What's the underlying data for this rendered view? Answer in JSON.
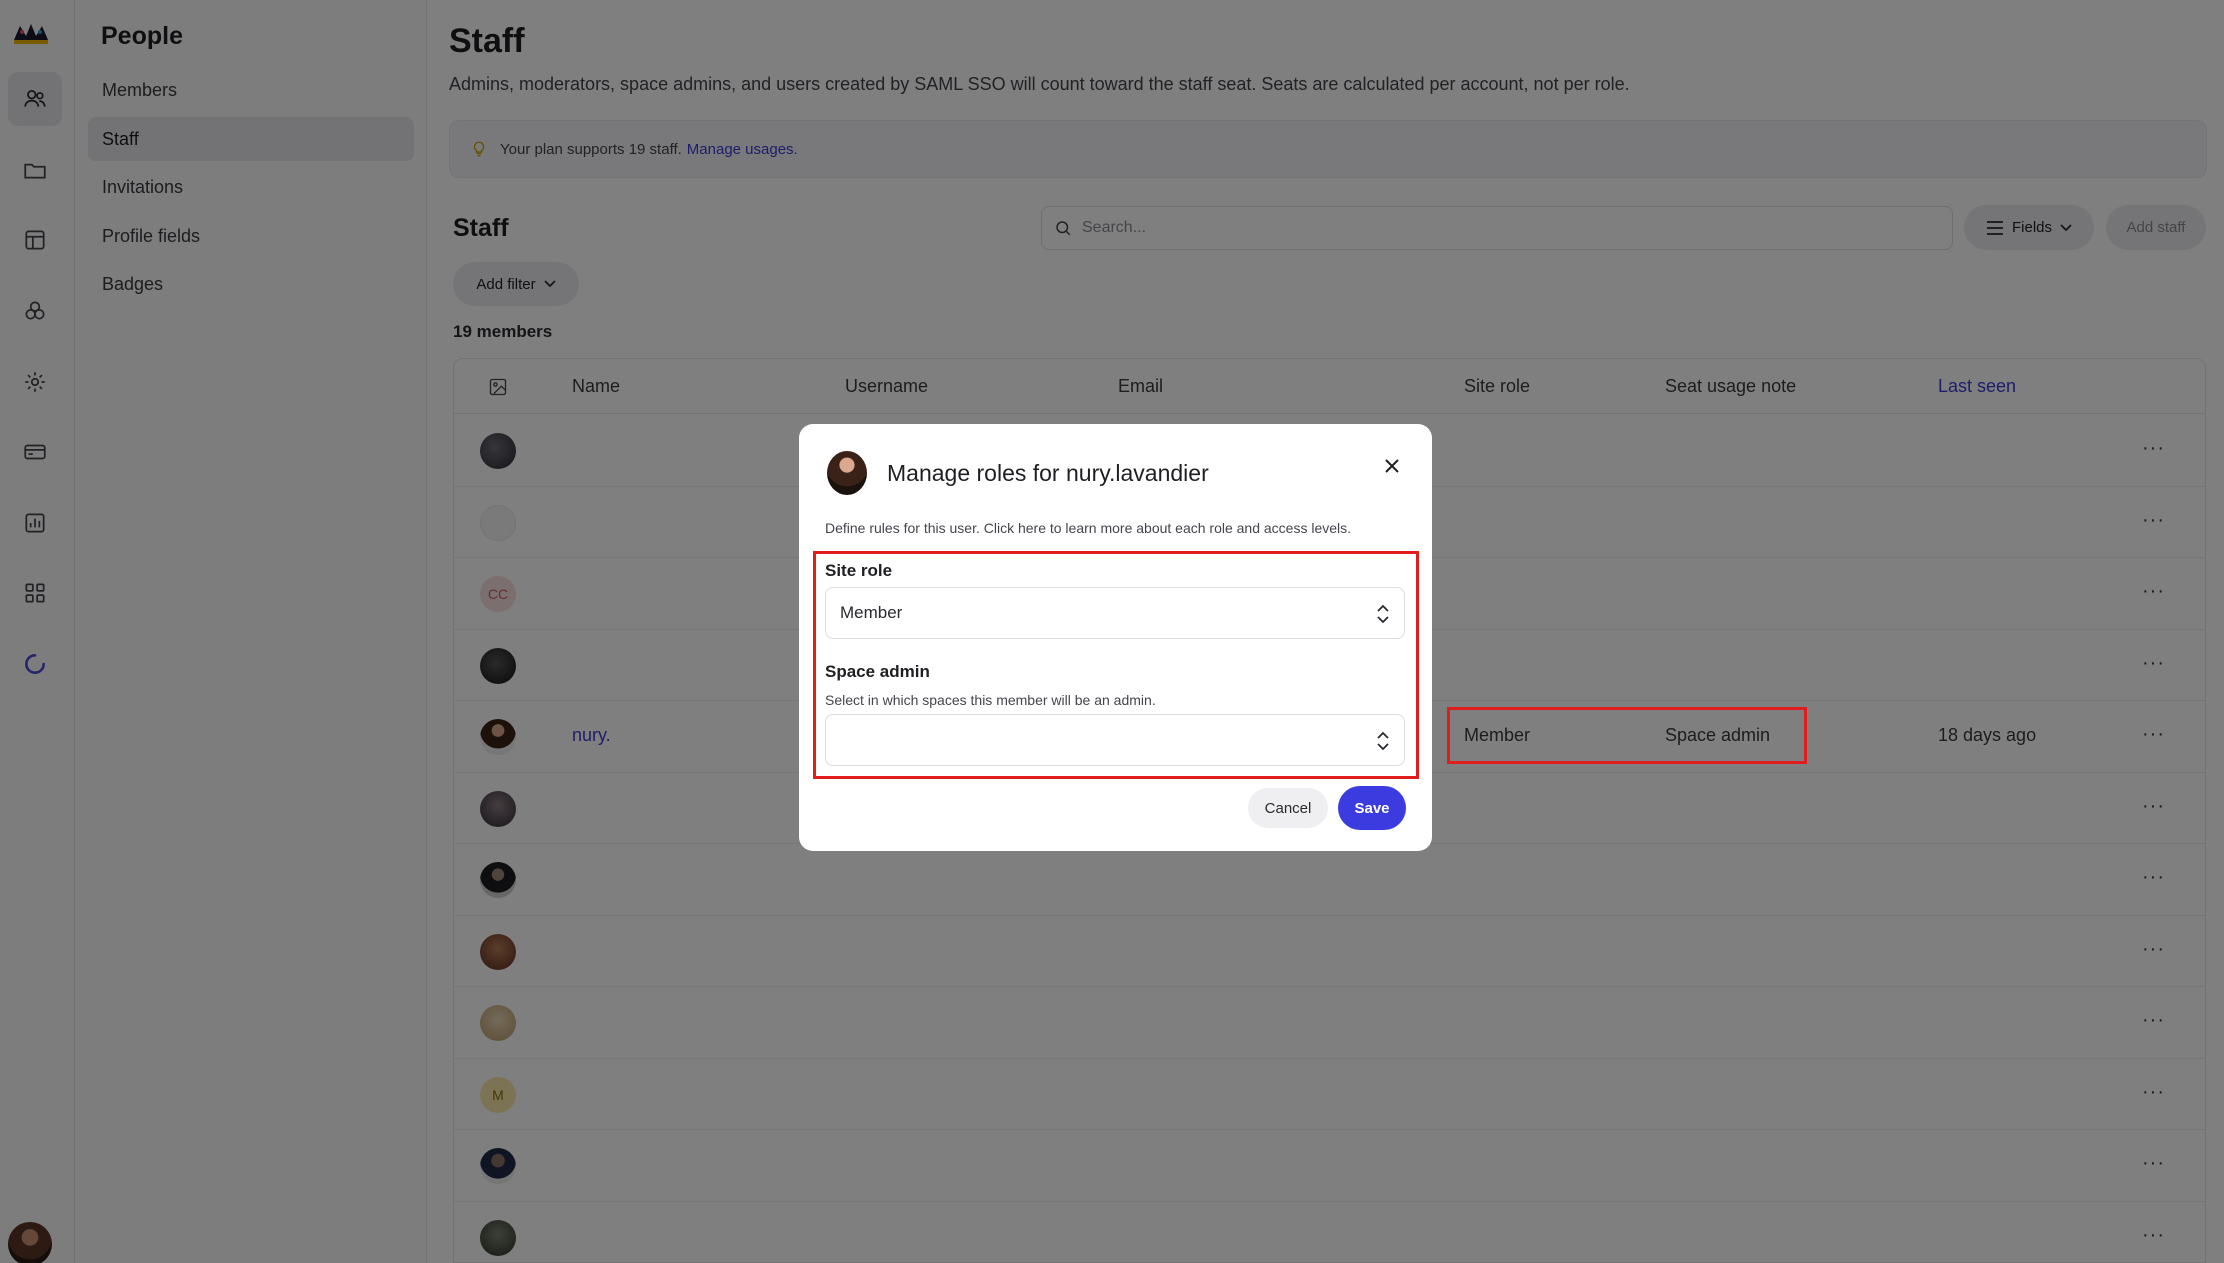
{
  "sidebar": {
    "title": "People",
    "items": [
      {
        "label": "Members",
        "active": false
      },
      {
        "label": "Staff",
        "active": true
      },
      {
        "label": "Invitations",
        "active": false
      },
      {
        "label": "Profile fields",
        "active": false
      },
      {
        "label": "Badges",
        "active": false
      }
    ]
  },
  "rail": {
    "icons": [
      "members-icon",
      "folder-icon",
      "layout-icon",
      "groups-icon",
      "gear-icon",
      "card-icon",
      "chart-icon",
      "apps-icon",
      "loading-icon"
    ]
  },
  "page": {
    "title": "Staff",
    "description": "Admins, moderators, space admins, and users created by SAML SSO will count toward the staff seat. Seats are calculated per account, not per role.",
    "plan_text": "Your plan supports 19 staff.",
    "plan_link": "Manage usages."
  },
  "list": {
    "title": "Staff",
    "search_placeholder": "Search...",
    "fields_label": "Fields",
    "add_staff_label": "Add staff",
    "add_filter_label": "Add filter",
    "count_label": "19 members",
    "columns": [
      "Name",
      "Username",
      "Email",
      "Site role",
      "Seat usage note",
      "Last seen"
    ],
    "rows": [
      {
        "avatar": "photo",
        "name": "",
        "site_role": "",
        "seat_note": "",
        "last_seen": ""
      },
      {
        "avatar": "photo",
        "name": "",
        "site_role": "",
        "seat_note": "",
        "last_seen": ""
      },
      {
        "avatar": "initials",
        "initials": "CC",
        "name": "",
        "site_role": "",
        "seat_note": "",
        "last_seen": ""
      },
      {
        "avatar": "photo",
        "name": "",
        "site_role": "",
        "seat_note": "",
        "last_seen": ""
      },
      {
        "avatar": "photo",
        "name": "nury.",
        "site_role": "Member",
        "seat_note": "Space admin",
        "last_seen": "18 days ago"
      },
      {
        "avatar": "photo",
        "name": "",
        "site_role": "",
        "seat_note": "",
        "last_seen": ""
      },
      {
        "avatar": "photo",
        "name": "",
        "site_role": "",
        "seat_note": "",
        "last_seen": ""
      },
      {
        "avatar": "photo",
        "name": "",
        "site_role": "",
        "seat_note": "",
        "last_seen": ""
      },
      {
        "avatar": "photo",
        "name": "",
        "site_role": "",
        "seat_note": "",
        "last_seen": ""
      },
      {
        "avatar": "initials",
        "initials": "M",
        "name": "",
        "site_role": "",
        "seat_note": "",
        "last_seen": ""
      },
      {
        "avatar": "photo",
        "name": "",
        "site_role": "",
        "seat_note": "",
        "last_seen": ""
      },
      {
        "avatar": "photo",
        "name": "",
        "site_role": "",
        "seat_note": "",
        "last_seen": ""
      }
    ],
    "row_menu": "···"
  },
  "modal": {
    "title": "Manage roles for nury.lavandier",
    "description": "Define rules for this user. Click here to learn more about each role and access levels.",
    "site_role_label": "Site role",
    "site_role_value": "Member",
    "space_admin_label": "Space admin",
    "space_admin_help": "Select in which spaces this member will be an admin.",
    "space_admin_value": "",
    "cancel_label": "Cancel",
    "save_label": "Save"
  },
  "colors": {
    "accent": "#3b3be0",
    "link": "#3b3bd6",
    "highlight": "#e01c1c"
  }
}
